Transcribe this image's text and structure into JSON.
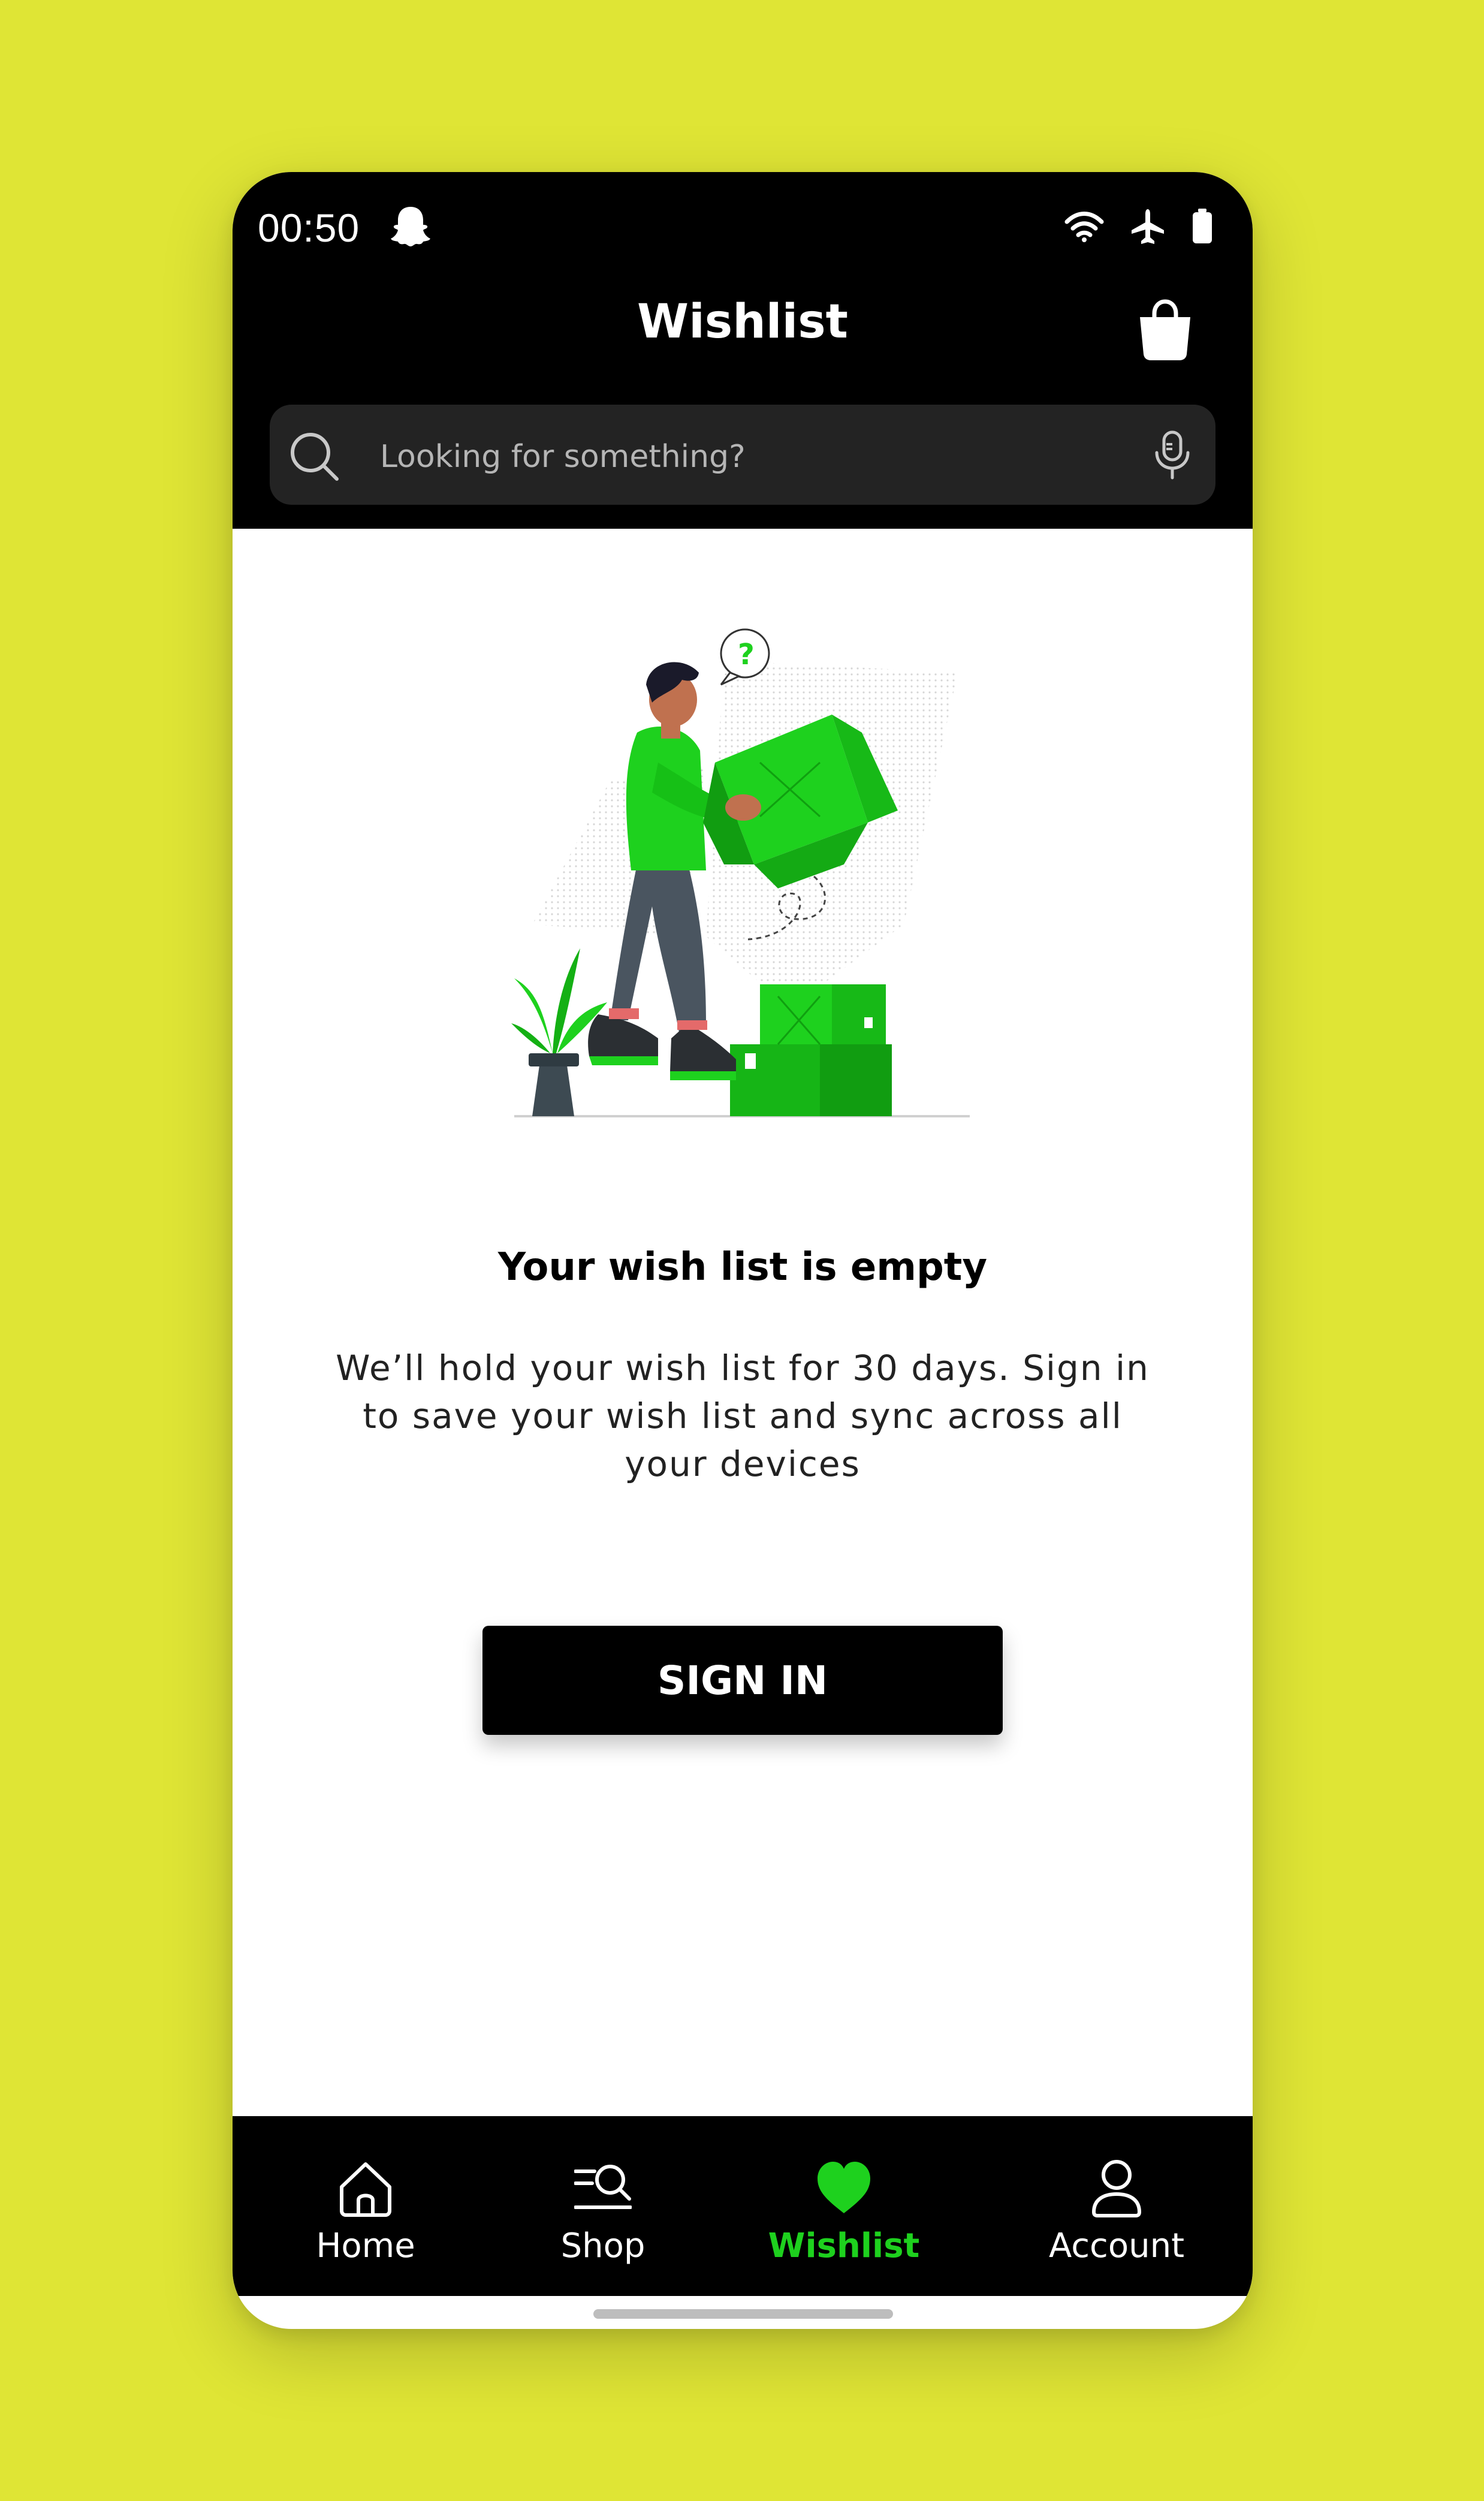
{
  "status_bar": {
    "time": "00:50",
    "icons": [
      "snapchat-ghost-icon",
      "wifi-icon",
      "airplane-icon",
      "battery-icon"
    ]
  },
  "header": {
    "title": "Wishlist",
    "cart_icon": "shopping-bag-icon"
  },
  "search": {
    "placeholder": "Looking for something?",
    "left_icon": "search-icon",
    "right_icon": "microphone-icon"
  },
  "empty_state": {
    "title": "Your wish list is empty",
    "description": "We’ll hold your wish list for 30 days. Sign in to save your wish list and sync across all your devices",
    "illustration": "person-unpacking-green-boxes"
  },
  "sign_in_button": {
    "label": "SIGN IN"
  },
  "bottom_nav": {
    "items": [
      {
        "label": "Home",
        "icon": "home-icon",
        "active": false
      },
      {
        "label": "Shop",
        "icon": "shop-search-icon",
        "active": false
      },
      {
        "label": "Wishlist",
        "icon": "heart-icon",
        "active": true
      },
      {
        "label": "Account",
        "icon": "user-icon",
        "active": false
      }
    ]
  },
  "colors": {
    "background": "#dfe535",
    "accent_green": "#1ed11e",
    "header": "#000000",
    "search_field": "#232323"
  }
}
